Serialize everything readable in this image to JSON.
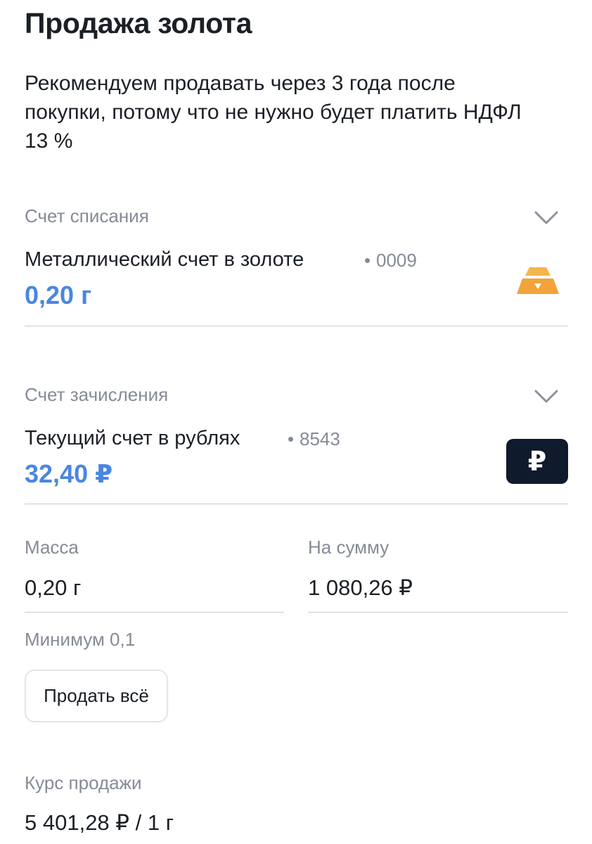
{
  "page": {
    "title": "Продажа золота",
    "description": "Рекомендуем продавать через 3 года после покупки, потому что не нужно будет платить НДФЛ 13 %"
  },
  "debit_account": {
    "label": "Счет списания",
    "name": "Металлический счет в золоте",
    "number": "0009",
    "balance": "0,20 г",
    "icon": "gold-bar-icon",
    "icon_color": "#f2a33a"
  },
  "credit_account": {
    "label": "Счет зачисления",
    "name": "Текущий счет в рублях",
    "number": "8543",
    "balance": "32,40 ₽",
    "icon": "ruble-icon",
    "icon_glyph": "₽",
    "icon_color": "#0f1a2c"
  },
  "mass": {
    "label": "Масса",
    "value": "0,20 г",
    "hint": "Минимум 0,1"
  },
  "sum": {
    "label": "На сумму",
    "value": "1 080,26 ₽"
  },
  "sell_all_label": "Продать всё",
  "rate": {
    "label": "Курс продажи",
    "value": "5 401,28 ₽ / 1 г"
  },
  "colors": {
    "accent": "#4a86e2",
    "muted": "#858b96",
    "text": "#1b1f26"
  }
}
